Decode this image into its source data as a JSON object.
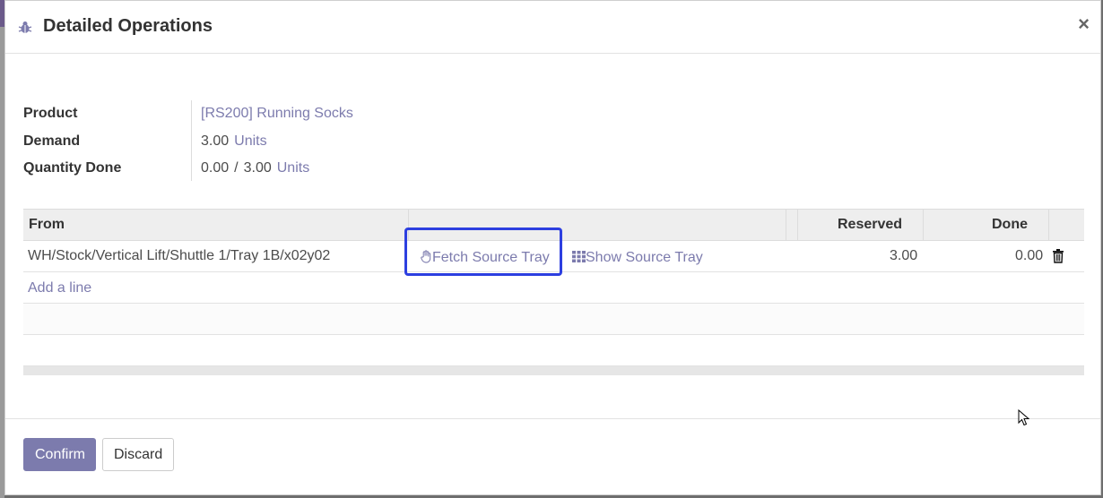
{
  "dialog": {
    "title": "Detailed Operations",
    "close_label": "×"
  },
  "fields": {
    "product_label": "Product",
    "product_value": "[RS200] Running Socks",
    "demand_label": "Demand",
    "demand_qty": "3.00",
    "demand_uom": "Units",
    "qty_done_label": "Quantity Done",
    "qty_done_value": "0.00",
    "qty_done_sep": "/",
    "qty_done_total": "3.00",
    "qty_done_uom": "Units"
  },
  "table": {
    "headers": {
      "from": "From",
      "reserved": "Reserved",
      "done": "Done"
    },
    "rows": [
      {
        "from": "WH/Stock/Vertical Lift/Shuttle 1/Tray 1B/x02y02",
        "fetch_label": "Fetch Source Tray",
        "show_label": "Show Source Tray",
        "reserved": "3.00",
        "done": "0.00"
      }
    ],
    "add_line_label": "Add a line"
  },
  "footer": {
    "confirm_label": "Confirm",
    "discard_label": "Discard"
  },
  "colors": {
    "accent": "#7c7bad",
    "highlight": "#2d3fe0"
  },
  "icons": [
    "bug-icon",
    "close-icon",
    "hand-icon",
    "grid-icon",
    "trash-icon"
  ]
}
